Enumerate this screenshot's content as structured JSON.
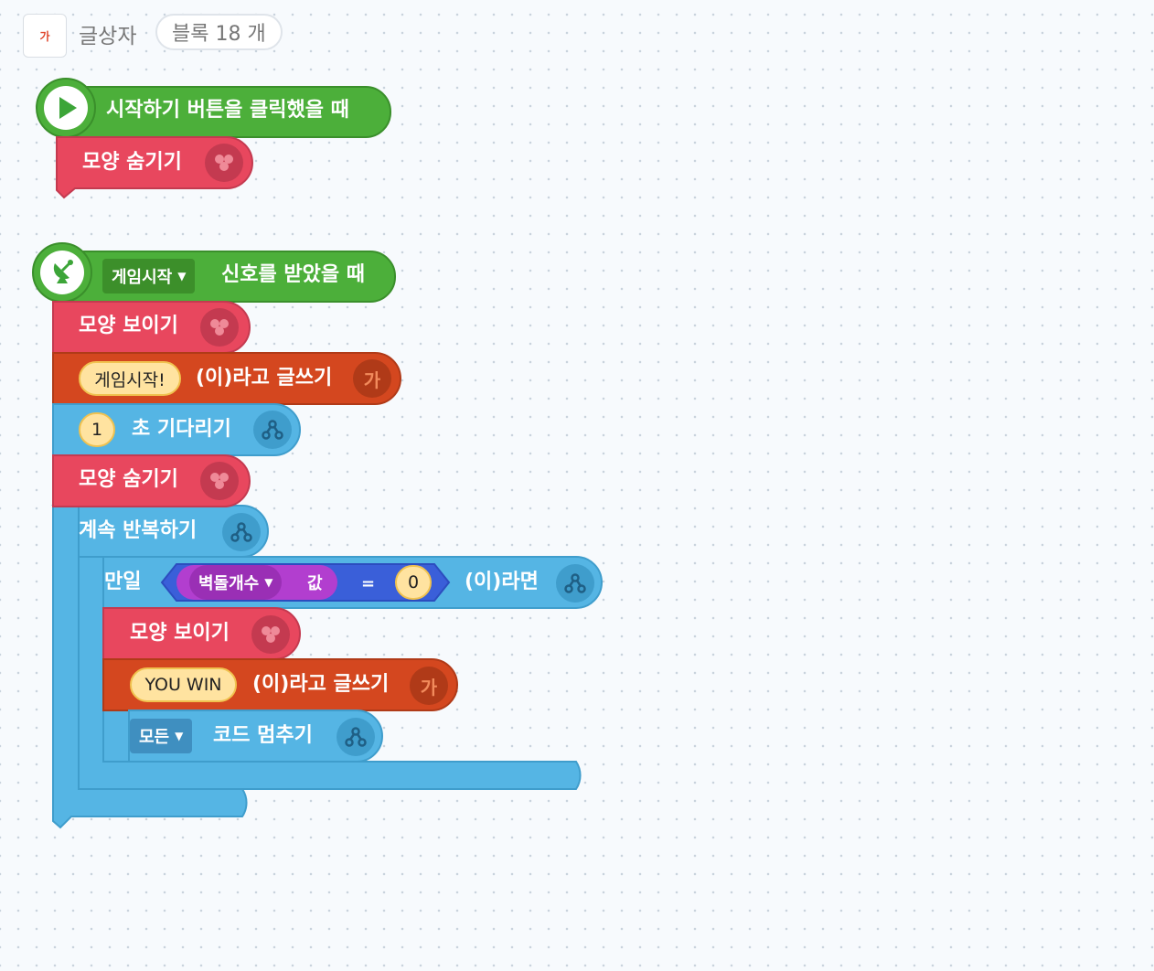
{
  "header": {
    "icon_text": "가",
    "title": "글상자",
    "block_count": "블록 18 개"
  },
  "script1": {
    "event_label": "시작하기 버튼을 클릭했을 때",
    "hide_label": "모양 숨기기"
  },
  "script2": {
    "signal_dropdown": "게임시작",
    "signal_label": "신호를 받았을 때",
    "show_label": "모양 보이기",
    "write_text_value": "게임시작!",
    "write_label": "(이)라고 글쓰기",
    "write_icon": "가",
    "wait_value": "1",
    "wait_label": "초 기다리기",
    "hide_label": "모양 숨기기",
    "repeat_label": "계속 반복하기",
    "if_label": "만일",
    "variable_dropdown": "벽돌개수",
    "variable_value_label": "값",
    "operator": "=",
    "compare_value": "0",
    "then_label": "(이)라면",
    "inner_show_label": "모양 보이기",
    "inner_write_value": "YOU WIN",
    "inner_write_label": "(이)라고 글쓰기",
    "inner_write_icon": "가",
    "stop_dropdown": "모든",
    "stop_label": "코드 멈추기"
  },
  "colors": {
    "event_green": "#4caf3a",
    "looks_red": "#e8475e",
    "text_orange": "#d4471f",
    "flow_blue": "#55b5e4",
    "variable_purple": "#b23ecf",
    "operator_blue": "#3a5fd9",
    "value_yellow": "#ffe3a0"
  }
}
